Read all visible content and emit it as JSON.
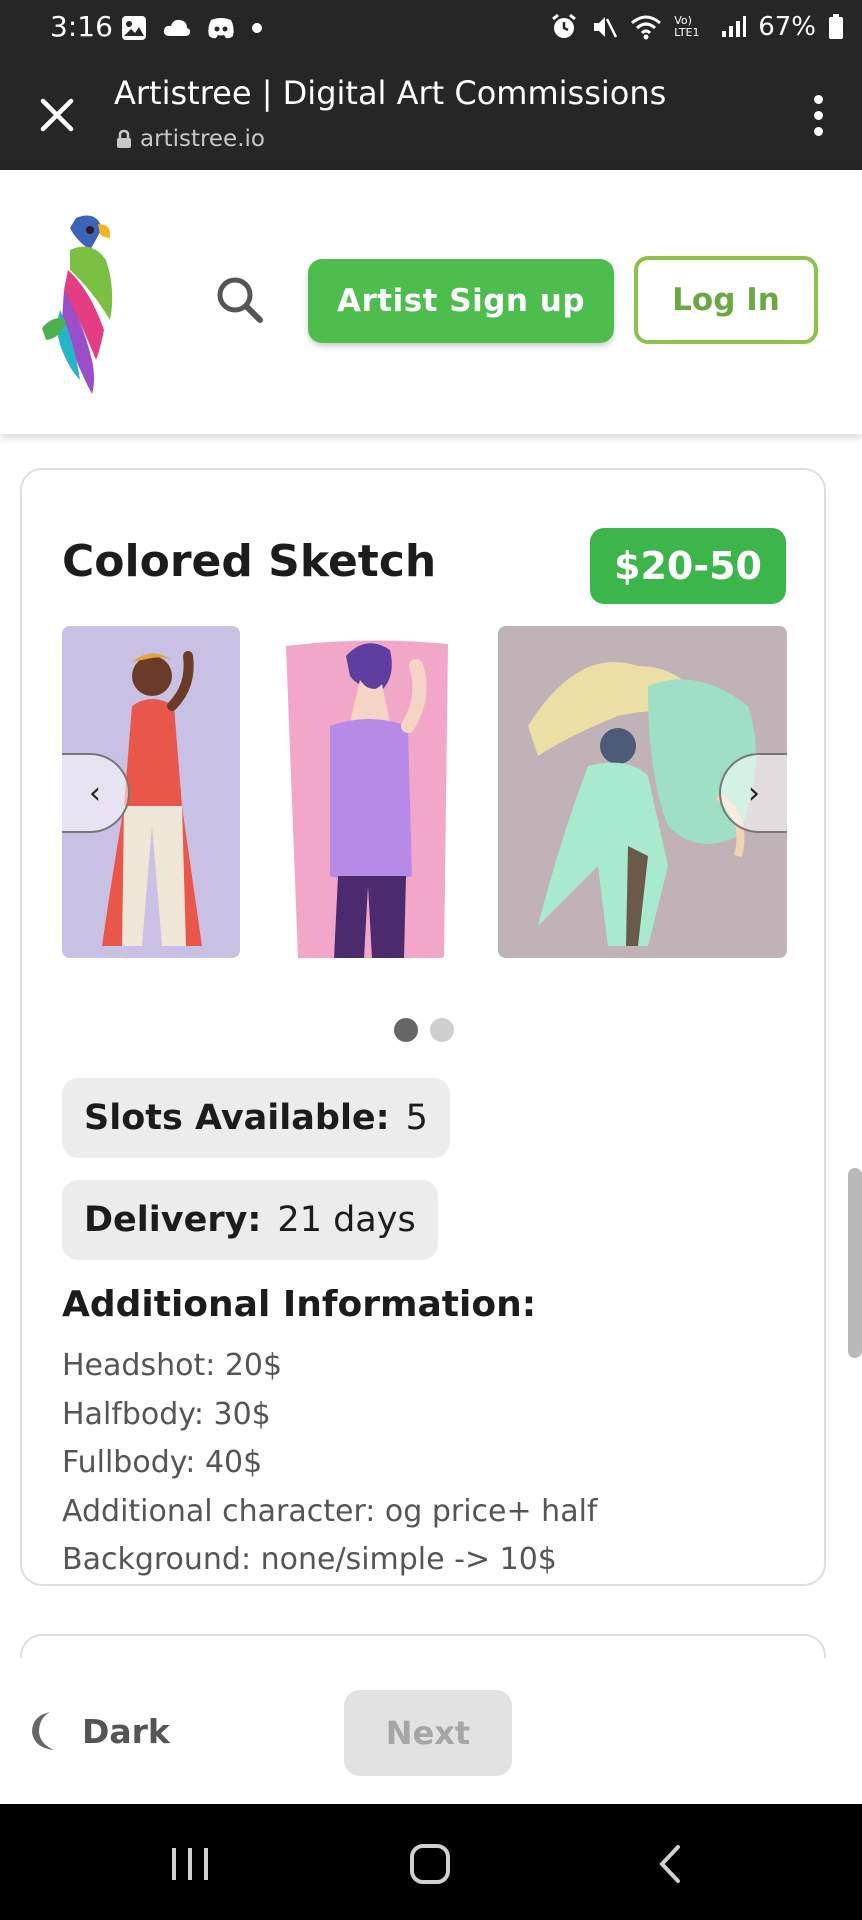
{
  "status_bar": {
    "time": "3:16",
    "battery": "67%",
    "network_label": "Vo) LTE1"
  },
  "browser": {
    "page_title": "Artistree | Digital Art Commissions",
    "url": "artistree.io"
  },
  "header": {
    "signup_label": "Artist Sign up",
    "login_label": "Log In"
  },
  "commission": {
    "title": "Colored Sketch",
    "price": "$20-50",
    "slots_label": "Slots Available:",
    "slots_value": "5",
    "delivery_label": "Delivery:",
    "delivery_value": "21 days",
    "additional_title": "Additional Information:",
    "additional_lines": [
      "Headshot: 20$",
      "Halfbody: 30$",
      "Fullbody: 40$",
      "Additional character: og price+ half",
      "Background: none/simple -> 10$"
    ],
    "carousel_prev": "‹",
    "carousel_next": "›"
  },
  "footer": {
    "dark_label": "Dark",
    "next_label": "Next"
  },
  "colors": {
    "brand_green": "#4dbd4e",
    "price_green": "#3cb54a",
    "login_border": "#8bc34a",
    "toolbar_bg": "#262626"
  }
}
